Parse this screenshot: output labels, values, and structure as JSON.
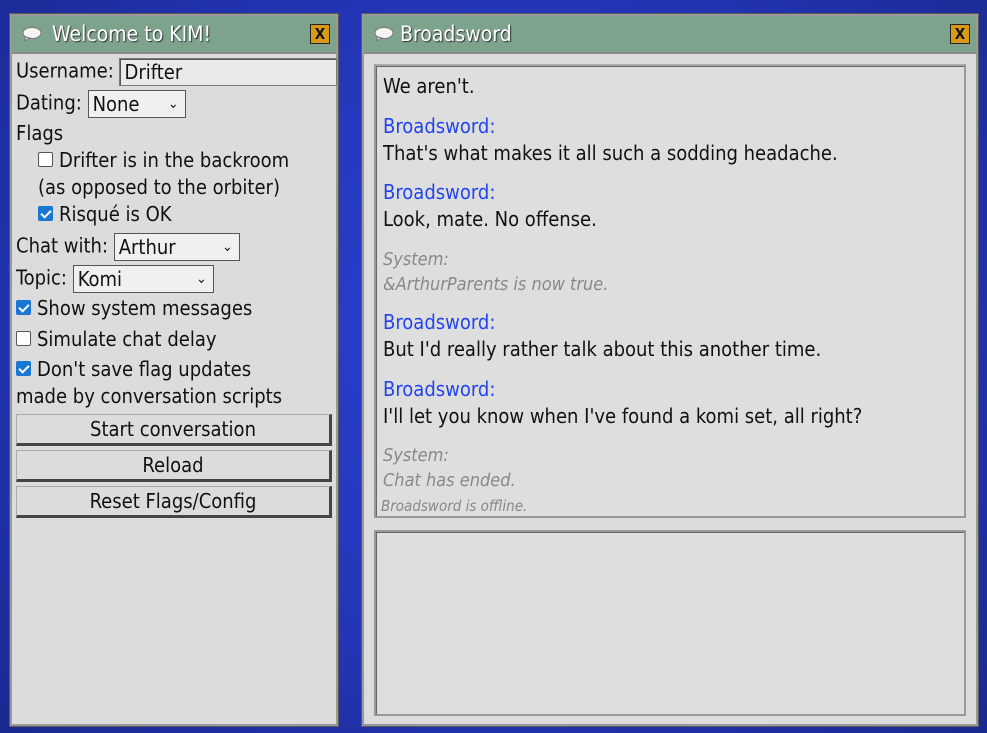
{
  "left_window": {
    "title": "Welcome to KIM!",
    "close_label": "X",
    "username_label": "Username:",
    "username_value": "Drifter",
    "dating_label": "Dating:",
    "dating_value": "None",
    "flags_label": "Flags",
    "flag_backroom_line1": "Drifter is in the backroom",
    "flag_backroom_line2": "(as opposed to the orbiter)",
    "flag_backroom_checked": false,
    "flag_risque": "Risqué is OK",
    "flag_risque_checked": true,
    "chat_with_label": "Chat with:",
    "chat_with_value": "Arthur",
    "topic_label": "Topic:",
    "topic_value": "Komi",
    "show_system_label": "Show system messages",
    "show_system_checked": true,
    "simulate_delay_label": "Simulate chat delay",
    "simulate_delay_checked": false,
    "dont_save_line1": "Don't save flag updates",
    "dont_save_line2": "made by conversation scripts",
    "dont_save_checked": true,
    "start_button": "Start conversation",
    "reload_button": "Reload",
    "reset_button": "Reset Flags/Config"
  },
  "right_window": {
    "title": "Broadsword",
    "close_label": "X",
    "messages": [
      {
        "text": "We aren't."
      },
      {
        "speaker": "Broadsword:",
        "text": "That's what makes it all such a sodding headache."
      },
      {
        "speaker": "Broadsword:",
        "text": "Look, mate. No offense."
      },
      {
        "speaker": "System:",
        "text": "&ArthurParents is now true."
      },
      {
        "speaker": "Broadsword:",
        "text": "But I'd really rather talk about this another time."
      },
      {
        "speaker": "Broadsword:",
        "text": "I'll let you know when I've found a komi set, all right?"
      },
      {
        "speaker": "System:",
        "text": "Chat has ended."
      }
    ],
    "status": "Broadsword is offline."
  },
  "colors": {
    "titlebar": "#7ea38d",
    "close_button": "#d89a16",
    "speaker": "#2244ee",
    "system_text": "#888888",
    "background": "#2436b8"
  }
}
